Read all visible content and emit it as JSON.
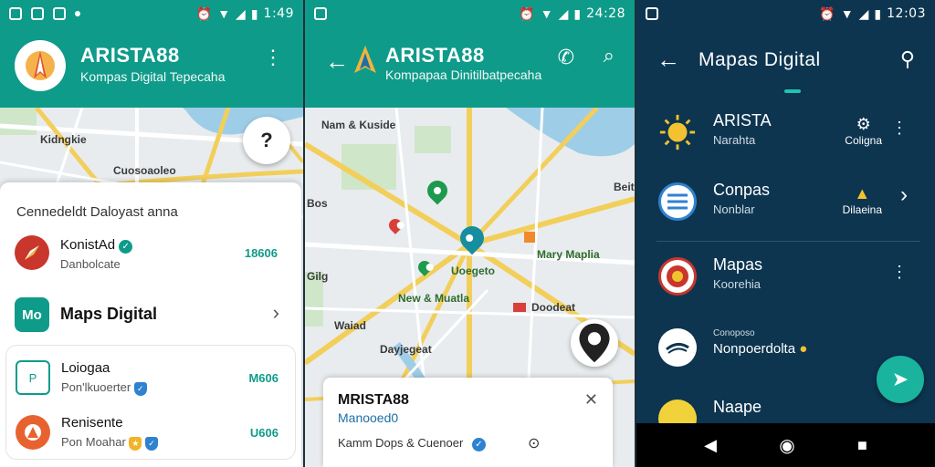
{
  "colors": {
    "teal": "#0f9b89",
    "navy": "#0d3550",
    "map_bg": "#e9ecee",
    "road": "#f2cf5b"
  },
  "screens": [
    {
      "status_time": "1:49",
      "app_title": "ARISTA88",
      "app_subtitle": "Kompas Digital Tepecaha",
      "menu_icon": "more-vert-icon",
      "map_labels": [
        "Kidngkie",
        "Cuosoaoleo"
      ],
      "help_button": "?",
      "sheet": {
        "heading": "Cennedeldt Daloyast anna",
        "rows": [
          {
            "title": "KonistAd",
            "subtitle": "Danbolcate",
            "value": "18606",
            "badge": "check-icon"
          },
          {
            "title": "Maps Digital",
            "logo_text": "Mo",
            "action": "chevron-right-icon"
          },
          {
            "title": "Loiogaa",
            "subtitle": "Pon'lkuoerter",
            "value": "M606",
            "badge": "shield-icon"
          },
          {
            "title": "Renisente",
            "subtitle": "Pon Moahar",
            "value": "U606",
            "badge": "shield-icon"
          }
        ]
      }
    },
    {
      "status_time": "24:28",
      "app_title": "ARISTA88",
      "app_subtitle": "Kompapaa Dinitilbatpecaha",
      "map_labels": [
        "Nam & Kuside",
        "Bos",
        "Beitr",
        "Uoegeto",
        "New & Muatla",
        "Mary Maplia",
        "Doodeat",
        "Dayjegeat",
        "Waiad",
        "Gilg"
      ],
      "info_card": {
        "title": "MRISTA88",
        "subtitle": "Manooed0",
        "footer": "Kamm Dops & Cuenoer",
        "close_icon": "close-icon"
      }
    },
    {
      "status_time": "12:03",
      "app_title": "Mapas Digital",
      "items": [
        {
          "title": "ARISTA",
          "subtitle": "Narahta",
          "meta": "Coligna"
        },
        {
          "title": "Conpas",
          "subtitle": "Nonblar",
          "meta": "Dilaeina"
        },
        {
          "title": "Mapas",
          "subtitle": "Koorehia"
        },
        {
          "title": "Nonpoerdolta",
          "subtitle": "Conoposo"
        },
        {
          "title": "Naape"
        }
      ]
    }
  ]
}
